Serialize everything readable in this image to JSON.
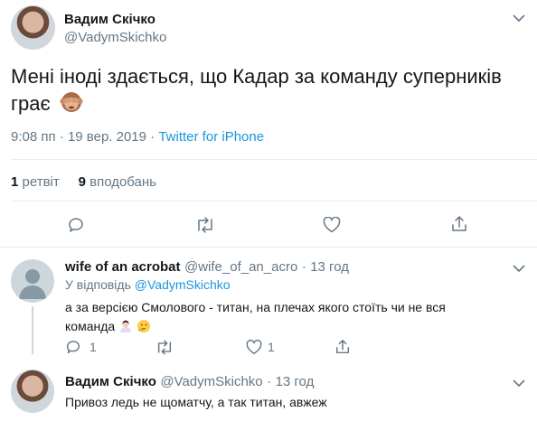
{
  "main_tweet": {
    "author_name": "Вадим Скічко",
    "author_handle": "@VadymSkichko",
    "text": "Мені іноді здається, що Кадар за команду суперників грає",
    "emoji": "see-no-evil-monkey",
    "time": "9:08 пп",
    "date": "19 вер. 2019",
    "meta_separator": "·",
    "source": "Twitter for iPhone",
    "retweets_count": "1",
    "retweets_label": "ретвіт",
    "likes_count": "9",
    "likes_label": "вподобань"
  },
  "replies": [
    {
      "author_name": "wife of an acrobat",
      "author_handle": "@wife_of_an_acro",
      "time_sep": "·",
      "time": "13 год",
      "reply_to_prefix": "У відповідь",
      "reply_to_handle": "@VadymSkichko",
      "text_line1": "а за версією Смолового - титан, на плечах якого стоїть чи не вся",
      "text_line2": "команда",
      "reply_count": "1",
      "retweet_count": "",
      "like_count": "1"
    },
    {
      "author_name": "Вадим Скічко",
      "author_handle": "@VadymSkichko",
      "time_sep": "·",
      "time": "13 год",
      "text": "Привоз ледь не щоматчу, а так титан, авжеж"
    }
  ],
  "colors": {
    "text": "#14171a",
    "secondary": "#657786",
    "link": "#1b95e0",
    "divider": "#e6ecf0"
  }
}
